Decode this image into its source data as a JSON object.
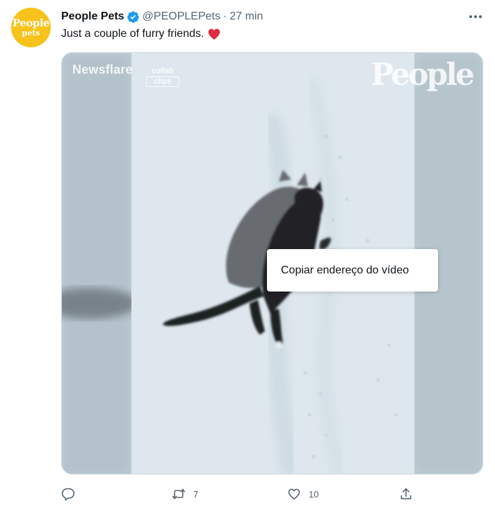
{
  "avatar": {
    "line1": "People",
    "line2": "pets",
    "color": "#f7c21a"
  },
  "tweet": {
    "author_name": "People Pets",
    "verified": true,
    "handle": "@PEOPLEPets",
    "separator": "·",
    "time": "27 min",
    "text": "Just a couple of furry friends.",
    "emoji": "red-heart"
  },
  "media": {
    "watermark_left": "Newsflare",
    "watermark_collab_top": "collab",
    "watermark_collab_bottom": "clips",
    "watermark_right": "People"
  },
  "context_menu": {
    "items": [
      "Copiar endereço do vídeo"
    ]
  },
  "actions": {
    "reply": {
      "icon": "reply-icon",
      "count": ""
    },
    "retweet": {
      "icon": "retweet-icon",
      "count": "7"
    },
    "like": {
      "icon": "heart-icon",
      "count": "10"
    },
    "share": {
      "icon": "share-icon",
      "count": ""
    }
  },
  "colors": {
    "text": "#0f1419",
    "muted": "#536471",
    "verified": "#1d9bf0",
    "heart": "#e0245e"
  }
}
